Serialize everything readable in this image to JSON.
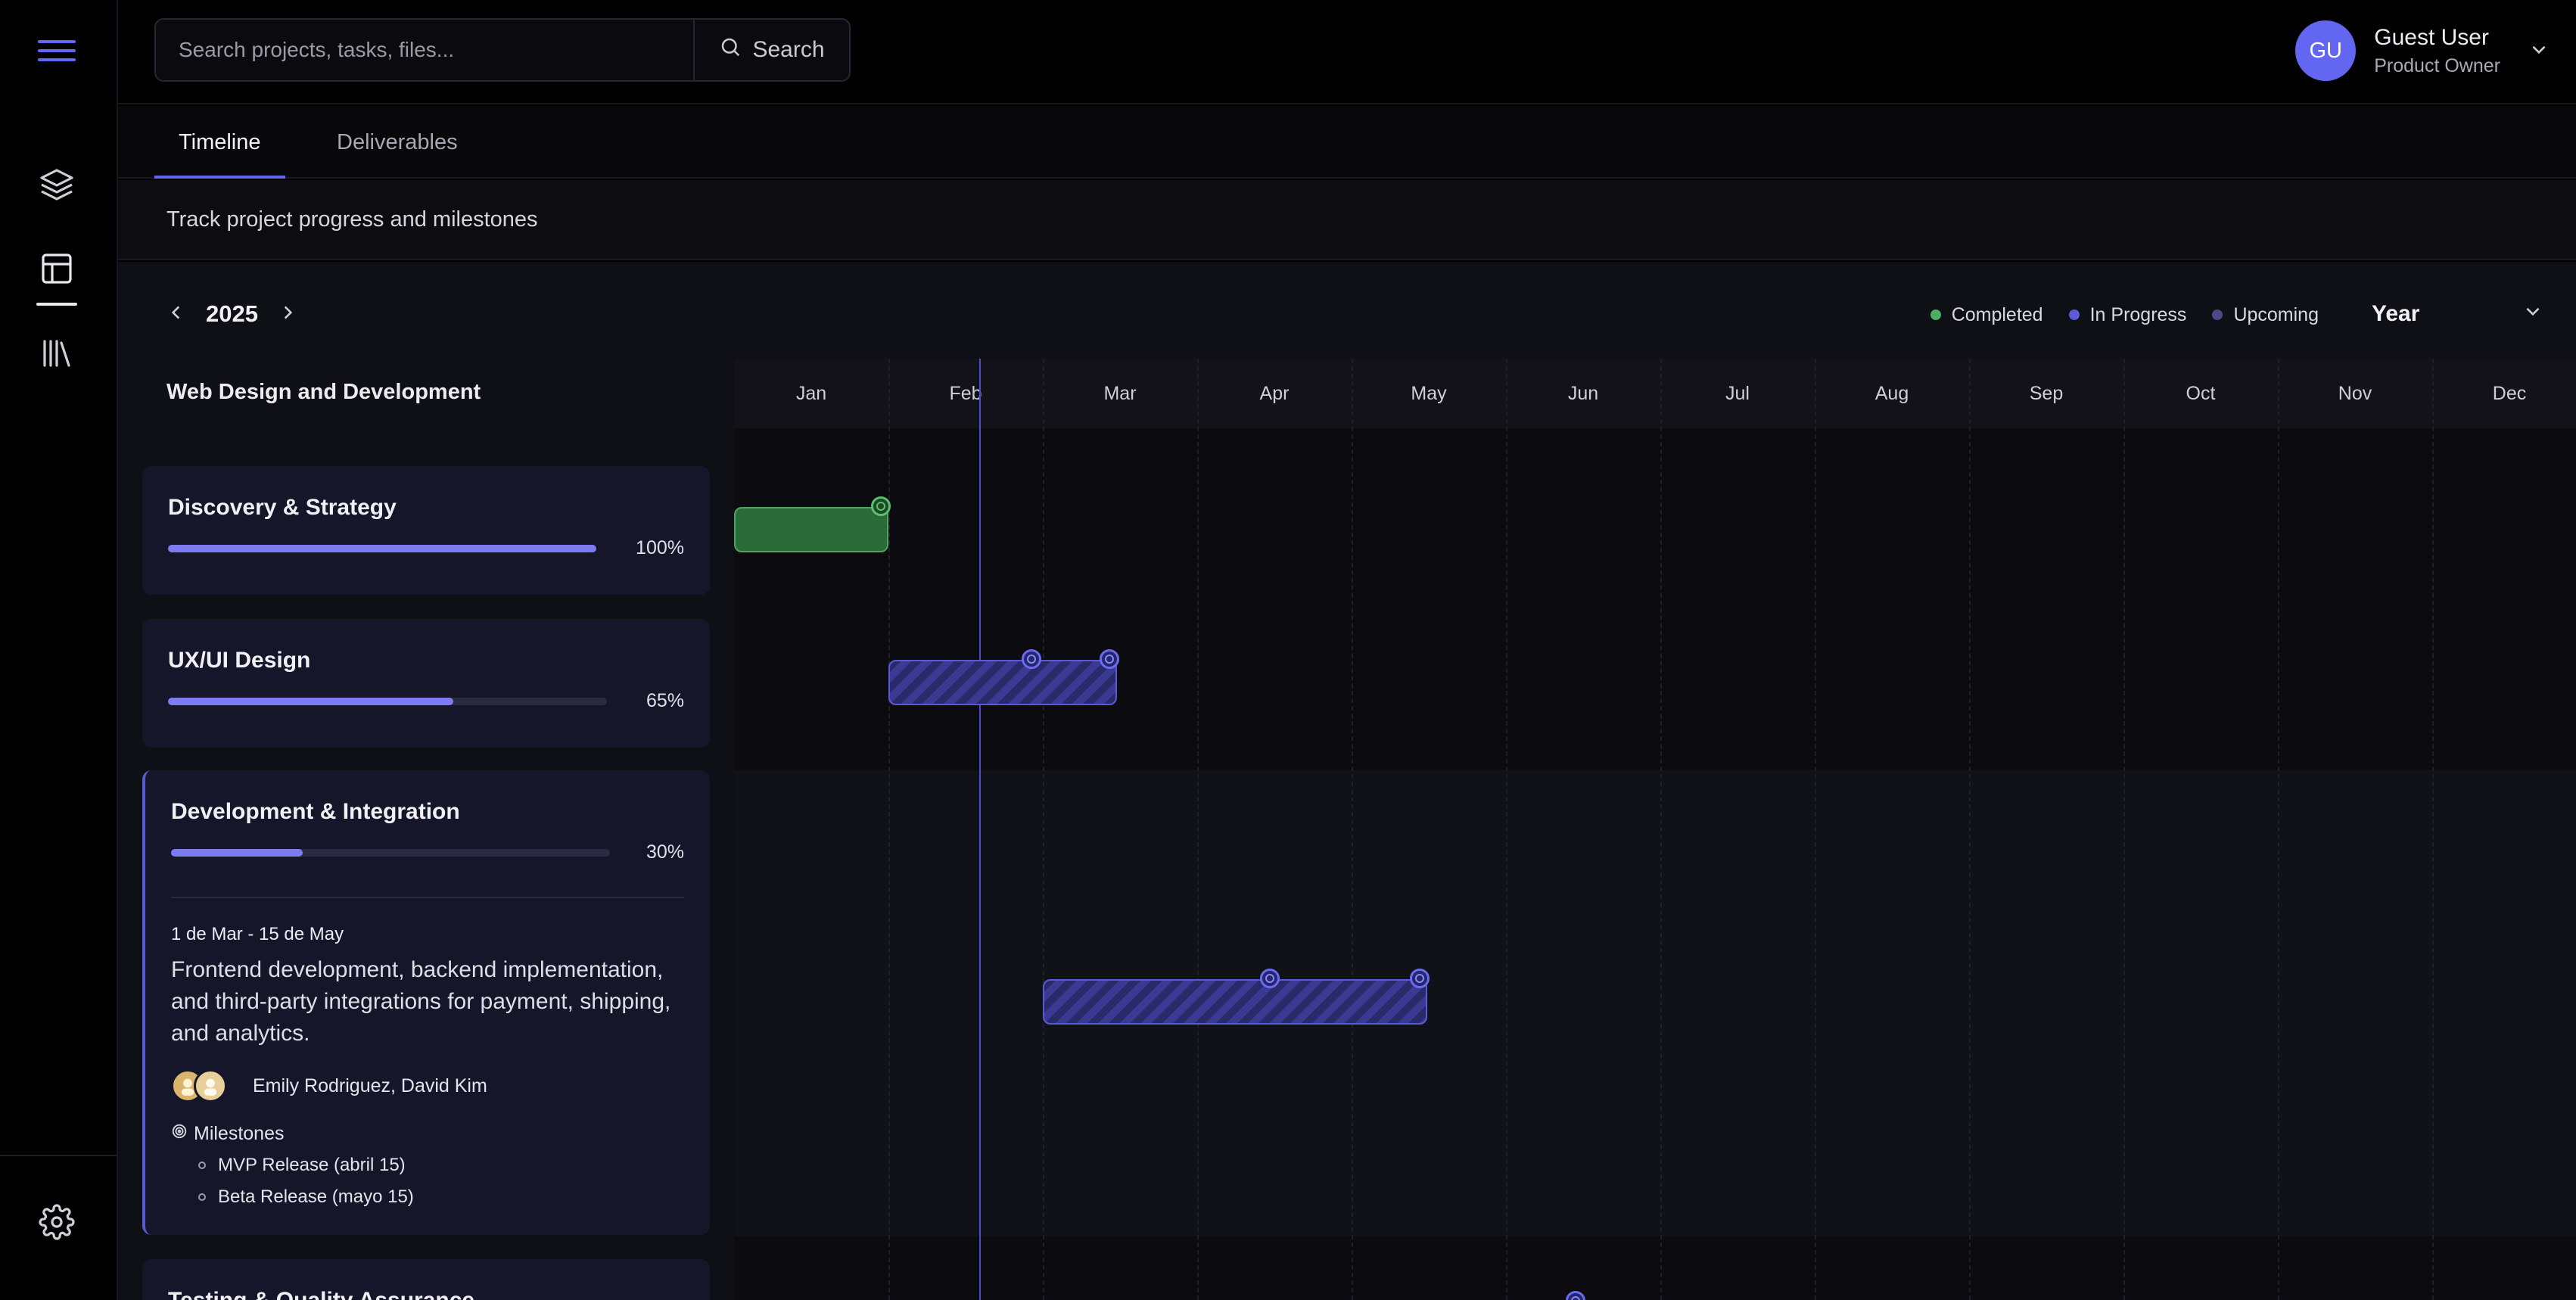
{
  "search": {
    "placeholder": "Search projects, tasks, files...",
    "button_label": "Search"
  },
  "user": {
    "initials": "GU",
    "name": "Guest User",
    "role": "Product Owner"
  },
  "tabs": [
    {
      "label": "Timeline",
      "active": true
    },
    {
      "label": "Deliverables",
      "active": false
    }
  ],
  "subtitle": "Track project progress and milestones",
  "year": "2025",
  "legend": [
    {
      "label": "Completed",
      "color": "#4caf63"
    },
    {
      "label": "In Progress",
      "color": "#5b5bd6"
    },
    {
      "label": "Upcoming",
      "color": "#4a4a8a"
    }
  ],
  "view": "Year",
  "project_title": "Web Design and Development",
  "phases": [
    {
      "title": "Discovery & Strategy",
      "progress": 100,
      "percent_label": "100%"
    },
    {
      "title": "UX/UI Design",
      "progress": 65,
      "percent_label": "65%"
    },
    {
      "title": "Development & Integration",
      "progress": 30,
      "percent_label": "30%",
      "dates": "1 de Mar - 15 de May",
      "description": "Frontend development, backend implementation, and third-party integrations for payment, shipping, and analytics.",
      "team": "Emily Rodriguez, David Kim",
      "milestones_label": "Milestones",
      "milestones": [
        "MVP Release (abril 15)",
        "Beta Release (mayo 15)"
      ]
    },
    {
      "title": "Testing & Quality Assurance"
    }
  ],
  "months": [
    "Jan",
    "Feb",
    "Mar",
    "Apr",
    "May",
    "Jun",
    "Jul",
    "Aug",
    "Sep",
    "Oct",
    "Nov",
    "Dec"
  ]
}
